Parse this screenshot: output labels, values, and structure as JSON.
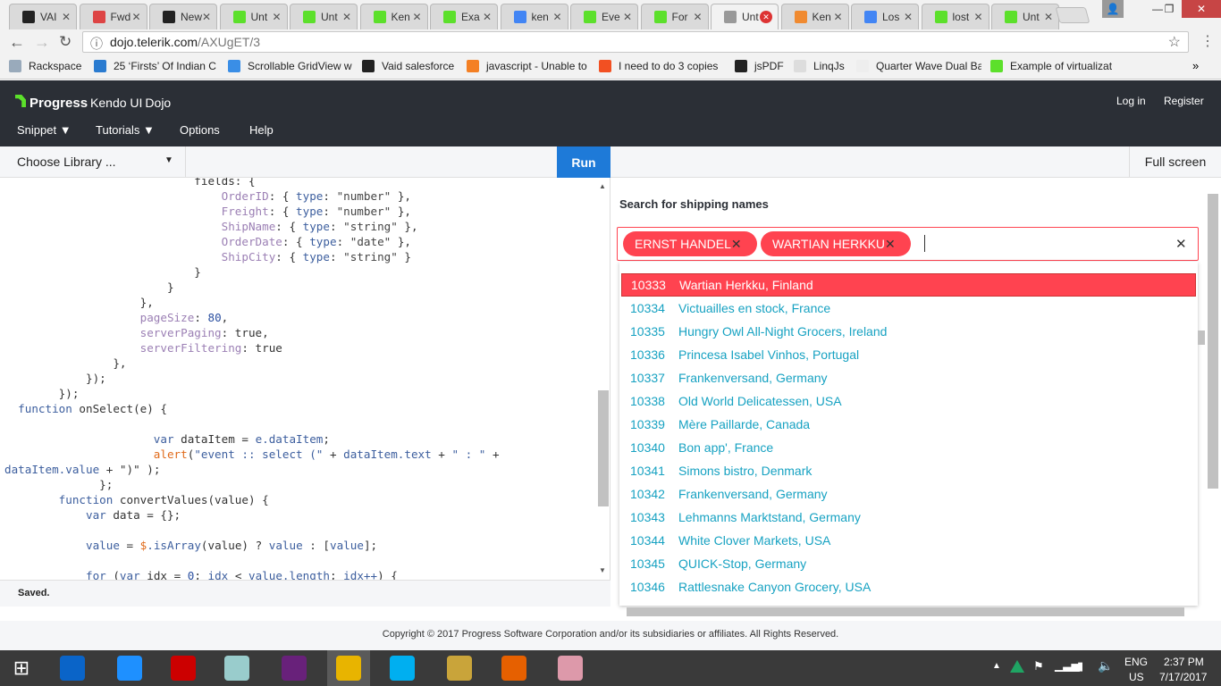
{
  "browser": {
    "tabs": [
      {
        "title": "VAI",
        "color": "#222"
      },
      {
        "title": "Fwd",
        "color": "#d44"
      },
      {
        "title": "New",
        "color": "#222"
      },
      {
        "title": "Unt",
        "color": "#5ce02b"
      },
      {
        "title": "Unt",
        "color": "#5ce02b"
      },
      {
        "title": "Ken",
        "color": "#5ce02b"
      },
      {
        "title": "Exa",
        "color": "#5ce02b"
      },
      {
        "title": "ken",
        "color": "#4285f4"
      },
      {
        "title": "Eve",
        "color": "#5ce02b"
      },
      {
        "title": "For",
        "color": "#5ce02b"
      },
      {
        "title": "Unt",
        "color": "#999",
        "active": true,
        "error": true
      },
      {
        "title": "Ken",
        "color": "#f08a30"
      },
      {
        "title": "Los",
        "color": "#4285f4"
      },
      {
        "title": "lost",
        "color": "#5ce02b"
      },
      {
        "title": "Unt",
        "color": "#5ce02b"
      }
    ],
    "url_host": "dojo.telerik.com",
    "url_path": "/AXUgET/3",
    "bookmarks": [
      {
        "label": "Rackspace",
        "color": "#9ab"
      },
      {
        "label": "25 ‘Firsts’ Of Indian C",
        "color": "#2a7bd0"
      },
      {
        "label": "Scrollable GridView w",
        "color": "#3a8ee6"
      },
      {
        "label": "Vaid salesforce",
        "color": "#222"
      },
      {
        "label": "javascript - Unable to",
        "color": "#f48024"
      },
      {
        "label": "I need to do 3 copies",
        "color": "#f25022"
      },
      {
        "label": "jsPDF",
        "color": "#222"
      },
      {
        "label": "LinqJs",
        "color": "#ddd"
      },
      {
        "label": "Quarter Wave Dual Ba",
        "color": "#eee"
      },
      {
        "label": "Example of virtualizat",
        "color": "#5ce02b"
      }
    ],
    "more": "»"
  },
  "header": {
    "logo_main": "Progress",
    "logo_sub": "Kendo UI",
    "logo_dojo": "Dojo",
    "login": "Log in",
    "register": "Register",
    "nav": [
      {
        "label": "Snippet ▼"
      },
      {
        "label": "Tutorials ▼"
      },
      {
        "label": "Options"
      },
      {
        "label": "Help"
      }
    ]
  },
  "toolbar": {
    "library": "Choose Library ...",
    "run": "Run",
    "fullscreen": "Full screen"
  },
  "editor": {
    "lines": [
      [
        [
          28,
          "fields: {",
          "d"
        ]
      ],
      [
        [
          32,
          "OrderID",
          "p"
        ],
        [
          0,
          ": { ",
          "d"
        ],
        [
          0,
          "type",
          "k"
        ],
        [
          0,
          ": ",
          "d"
        ],
        [
          0,
          "\"number\"",
          "s"
        ],
        [
          0,
          " },",
          "d"
        ]
      ],
      [
        [
          32,
          "Freight",
          "p"
        ],
        [
          0,
          ": { ",
          "d"
        ],
        [
          0,
          "type",
          "k"
        ],
        [
          0,
          ": ",
          "d"
        ],
        [
          0,
          "\"number\"",
          "s"
        ],
        [
          0,
          " },",
          "d"
        ]
      ],
      [
        [
          32,
          "ShipName",
          "p"
        ],
        [
          0,
          ": { ",
          "d"
        ],
        [
          0,
          "type",
          "k"
        ],
        [
          0,
          ": ",
          "d"
        ],
        [
          0,
          "\"string\"",
          "s"
        ],
        [
          0,
          " },",
          "d"
        ]
      ],
      [
        [
          32,
          "OrderDate",
          "p"
        ],
        [
          0,
          ": { ",
          "d"
        ],
        [
          0,
          "type",
          "k"
        ],
        [
          0,
          ": ",
          "d"
        ],
        [
          0,
          "\"date\"",
          "s"
        ],
        [
          0,
          " },",
          "d"
        ]
      ],
      [
        [
          32,
          "ShipCity",
          "p"
        ],
        [
          0,
          ": { ",
          "d"
        ],
        [
          0,
          "type",
          "k"
        ],
        [
          0,
          ": ",
          "d"
        ],
        [
          0,
          "\"string\"",
          "s"
        ],
        [
          0,
          " }",
          "d"
        ]
      ],
      [
        [
          28,
          "}",
          "d"
        ]
      ],
      [
        [
          24,
          "}",
          "d"
        ]
      ],
      [
        [
          20,
          "},",
          "d"
        ]
      ],
      [
        [
          20,
          "pageSize",
          "p"
        ],
        [
          0,
          ": ",
          "d"
        ],
        [
          0,
          "80",
          "n"
        ],
        [
          0,
          ",",
          "d"
        ]
      ],
      [
        [
          20,
          "serverPaging",
          "p"
        ],
        [
          0,
          ": true,",
          "d"
        ]
      ],
      [
        [
          20,
          "serverFiltering",
          "p"
        ],
        [
          0,
          ": true",
          "d"
        ]
      ],
      [
        [
          16,
          "},",
          "d"
        ]
      ],
      [
        [
          12,
          "});",
          "d"
        ]
      ],
      [
        [
          8,
          "});",
          "d"
        ]
      ],
      [
        [
          2,
          "function",
          "k"
        ],
        [
          0,
          " onSelect(e) {",
          "d"
        ]
      ],
      [],
      [
        [
          22,
          "var",
          "k"
        ],
        [
          0,
          " dataItem = ",
          "d"
        ],
        [
          0,
          "e.dataItem",
          "k"
        ],
        [
          0,
          ";",
          "d"
        ]
      ],
      [
        [
          22,
          "alert",
          "f"
        ],
        [
          0,
          "(",
          "d"
        ],
        [
          0,
          "\"event :: select (\"",
          "k"
        ],
        [
          0,
          " + ",
          "d"
        ],
        [
          0,
          "dataItem.text",
          "k"
        ],
        [
          0,
          " + ",
          "d"
        ],
        [
          0,
          "\" : \"",
          "k"
        ],
        [
          0,
          " +",
          "d"
        ]
      ],
      [
        [
          0,
          "dataItem.value",
          "k"
        ],
        [
          0,
          " + \")\" );",
          "d"
        ]
      ],
      [
        [
          14,
          "};",
          "d"
        ]
      ],
      [
        [
          8,
          "function",
          "k"
        ],
        [
          0,
          " convertValues(value) {",
          "d"
        ]
      ],
      [
        [
          12,
          "var",
          "k"
        ],
        [
          0,
          " data = {};",
          "d"
        ]
      ],
      [],
      [
        [
          12,
          "value",
          "k"
        ],
        [
          0,
          " = ",
          "d"
        ],
        [
          0,
          "$",
          "f"
        ],
        [
          0,
          ".isArray",
          "k"
        ],
        [
          0,
          "(value) ? ",
          "d"
        ],
        [
          0,
          "value",
          "k"
        ],
        [
          0,
          " : [",
          "d"
        ],
        [
          0,
          "value",
          "k"
        ],
        [
          0,
          "];",
          "d"
        ]
      ],
      [],
      [
        [
          12,
          "for",
          "k"
        ],
        [
          0,
          " (",
          "d"
        ],
        [
          0,
          "var",
          "k"
        ],
        [
          0,
          " idx = ",
          "d"
        ],
        [
          0,
          "0",
          "n"
        ],
        [
          0,
          "; ",
          "d"
        ],
        [
          0,
          "idx",
          "k"
        ],
        [
          0,
          " < ",
          "d"
        ],
        [
          0,
          "value.length",
          "k"
        ],
        [
          0,
          "; ",
          "d"
        ],
        [
          0,
          "idx++",
          "k"
        ],
        [
          0,
          ") {",
          "d"
        ]
      ]
    ],
    "status": "Saved."
  },
  "preview": {
    "label": "Search for shipping names",
    "chips": [
      {
        "label": "ERNST HANDEL"
      },
      {
        "label": "WARTIAN HERKKU"
      }
    ],
    "remove_glyph": "✕",
    "clear_glyph": "✕",
    "items": [
      {
        "id": "10333",
        "name": "Wartian Herkku, Finland",
        "selected": true
      },
      {
        "id": "10334",
        "name": "Victuailles en stock, France"
      },
      {
        "id": "10335",
        "name": "Hungry Owl All-Night Grocers, Ireland"
      },
      {
        "id": "10336",
        "name": "Princesa Isabel Vinhos, Portugal"
      },
      {
        "id": "10337",
        "name": "Frankenversand, Germany"
      },
      {
        "id": "10338",
        "name": "Old World Delicatessen, USA"
      },
      {
        "id": "10339",
        "name": "Mère Paillarde, Canada"
      },
      {
        "id": "10340",
        "name": "Bon app', France"
      },
      {
        "id": "10341",
        "name": "Simons bistro, Denmark"
      },
      {
        "id": "10342",
        "name": "Frankenversand, Germany"
      },
      {
        "id": "10343",
        "name": "Lehmanns Marktstand, Germany"
      },
      {
        "id": "10344",
        "name": "White Clover Markets, USA"
      },
      {
        "id": "10345",
        "name": "QUICK-Stop, Germany"
      },
      {
        "id": "10346",
        "name": "Rattlesnake Canyon Grocery, USA"
      }
    ],
    "accent": "#ff4350",
    "item_color": "#17a2c2"
  },
  "footer": "Copyright © 2017 Progress Software Corporation and/or its subsidiaries or affiliates. All Rights Reserved.",
  "taskbar": {
    "apps": [
      {
        "name": "outlook",
        "color": "#0a64c8"
      },
      {
        "name": "internet-explorer",
        "color": "#1e90ff"
      },
      {
        "name": "filezilla",
        "color": "#c00"
      },
      {
        "name": "notepad",
        "color": "#9cc"
      },
      {
        "name": "visual-studio",
        "color": "#68217a"
      },
      {
        "name": "chrome",
        "color": "#e8b400",
        "active": true
      },
      {
        "name": "skype",
        "color": "#00aff0"
      },
      {
        "name": "tools",
        "color": "#c9a43a"
      },
      {
        "name": "firefox",
        "color": "#e66000"
      },
      {
        "name": "paint",
        "color": "#d9a"
      }
    ],
    "lang1": "ENG",
    "lang2": "US",
    "time": "2:37 PM",
    "date": "7/17/2017"
  }
}
